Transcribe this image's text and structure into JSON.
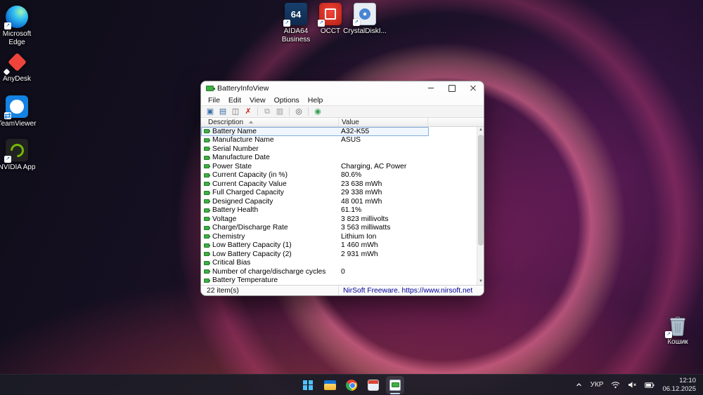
{
  "desktop": {
    "left_icons": [
      {
        "id": "edge",
        "label": "Microsoft Edge"
      },
      {
        "id": "anydesk",
        "label": "AnyDesk"
      },
      {
        "id": "teamviewer",
        "label": "TeamViewer"
      },
      {
        "id": "nvidia",
        "label": "NVIDIA App"
      }
    ],
    "top_icons": [
      {
        "id": "aida64",
        "label": "AIDA64 Business"
      },
      {
        "id": "occt",
        "label": "OCCT"
      },
      {
        "id": "crystaldisk",
        "label": "CrystalDiskI..."
      }
    ],
    "recycle_bin_label": "Кошик"
  },
  "window": {
    "title": "BatteryInfoView",
    "menu_items": [
      "File",
      "Edit",
      "View",
      "Options",
      "Help"
    ],
    "toolbar_icons": [
      {
        "name": "save-report-icon",
        "glyph": "save"
      },
      {
        "name": "export-icon",
        "glyph": "export"
      },
      {
        "name": "properties-icon",
        "glyph": "properties"
      },
      {
        "name": "delete-icon",
        "glyph": "delete"
      },
      {
        "name": "separator"
      },
      {
        "name": "copy-icon",
        "glyph": "copy"
      },
      {
        "name": "copy-value-icon",
        "glyph": "copy2"
      },
      {
        "name": "separator"
      },
      {
        "name": "find-icon",
        "glyph": "find"
      },
      {
        "name": "separator"
      },
      {
        "name": "advanced-options-icon",
        "glyph": "power"
      }
    ],
    "columns": {
      "description": "Description",
      "value": "Value"
    },
    "selected_index": 0,
    "rows": [
      {
        "description": "Battery Name",
        "value": "A32-K55"
      },
      {
        "description": "Manufacture Name",
        "value": "ASUS"
      },
      {
        "description": "Serial Number",
        "value": ""
      },
      {
        "description": "Manufacture Date",
        "value": ""
      },
      {
        "description": "Power State",
        "value": "Charging, AC Power"
      },
      {
        "description": "Current Capacity (in %)",
        "value": "80.6%"
      },
      {
        "description": "Current Capacity Value",
        "value": "23 638 mWh"
      },
      {
        "description": "Full Charged Capacity",
        "value": "29 338 mWh"
      },
      {
        "description": "Designed Capacity",
        "value": "48 001 mWh"
      },
      {
        "description": "Battery Health",
        "value": "61.1%"
      },
      {
        "description": "Voltage",
        "value": "3 823 millivolts"
      },
      {
        "description": "Charge/Discharge Rate",
        "value": "3 563 milliwatts"
      },
      {
        "description": "Chemistry",
        "value": "Lithium Ion"
      },
      {
        "description": "Low Battery Capacity (1)",
        "value": "1 460 mWh"
      },
      {
        "description": "Low Battery Capacity (2)",
        "value": "2 931 mWh"
      },
      {
        "description": "Critical Bias",
        "value": ""
      },
      {
        "description": "Number of charge/discharge cycles",
        "value": "0"
      },
      {
        "description": "Battery Temperature",
        "value": ""
      }
    ],
    "status_left": "22 item(s)",
    "status_link": "NirSoft Freeware. https://www.nirsoft.net"
  },
  "taskbar": {
    "language": "УКР",
    "time": "12:10",
    "date": "06.12.2025"
  },
  "colors": {
    "accent": "#0078d4",
    "status_link": "#00009b",
    "battery_green": "#3cb043",
    "selection_border": "#84acdd"
  }
}
